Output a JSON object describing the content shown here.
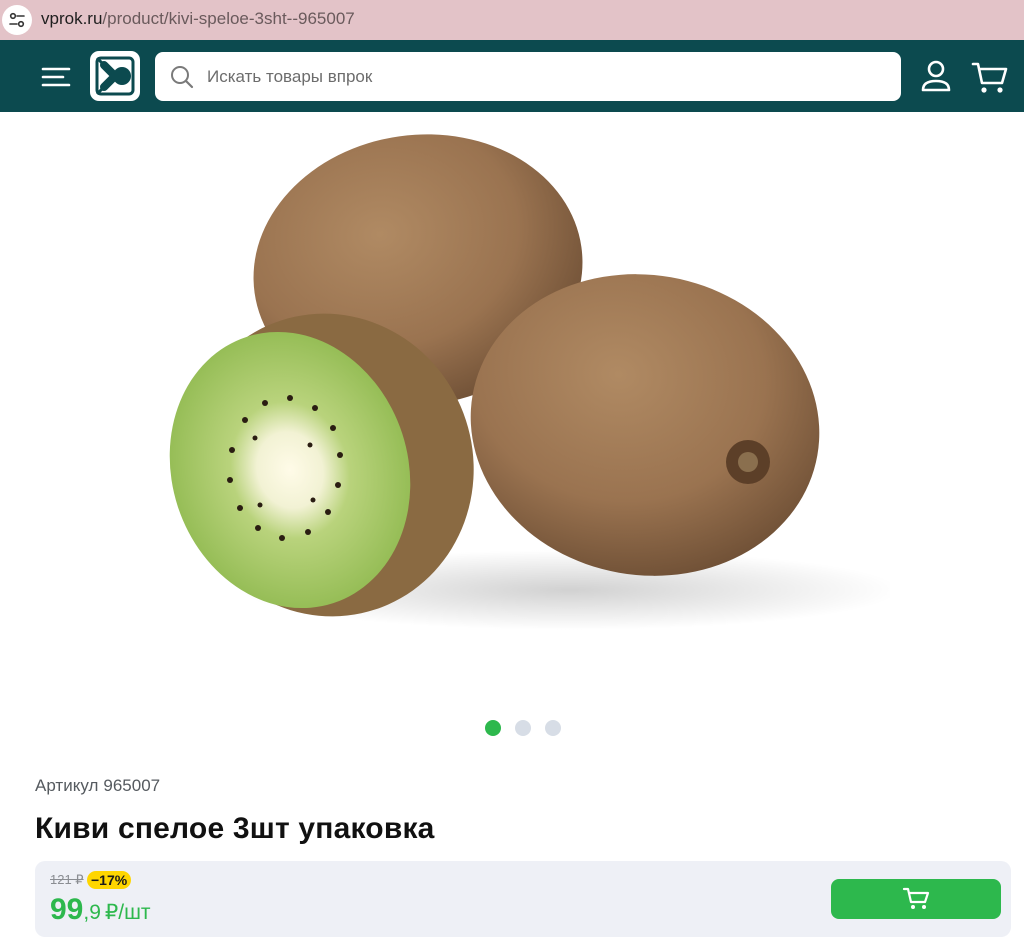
{
  "browser": {
    "url_domain": "vprok.ru",
    "url_path": "/product/kivi-speloe-3sht--965007"
  },
  "header": {
    "search_placeholder": "Искать товары впрок",
    "background_color": "#0c4a4f"
  },
  "icons": {
    "site_info": "tune-icon",
    "menu": "hamburger-menu-icon",
    "logo": "vprok-logo",
    "search": "search-icon",
    "profile": "user-icon",
    "cart": "cart-icon",
    "add_to_cart": "cart-icon"
  },
  "carousel": {
    "slide_count": 3,
    "active_index": 0,
    "active_color": "#2db84d"
  },
  "product": {
    "sku_label": "Артикул",
    "sku_value": "965007",
    "title": "Киви спелое 3шт упаковка"
  },
  "price": {
    "old": "121 ₽",
    "discount": "−17%",
    "integer": "99",
    "decimal": ",9",
    "unit": "₽/шт",
    "color": "#2db84d",
    "badge_color": "#ffd600"
  }
}
